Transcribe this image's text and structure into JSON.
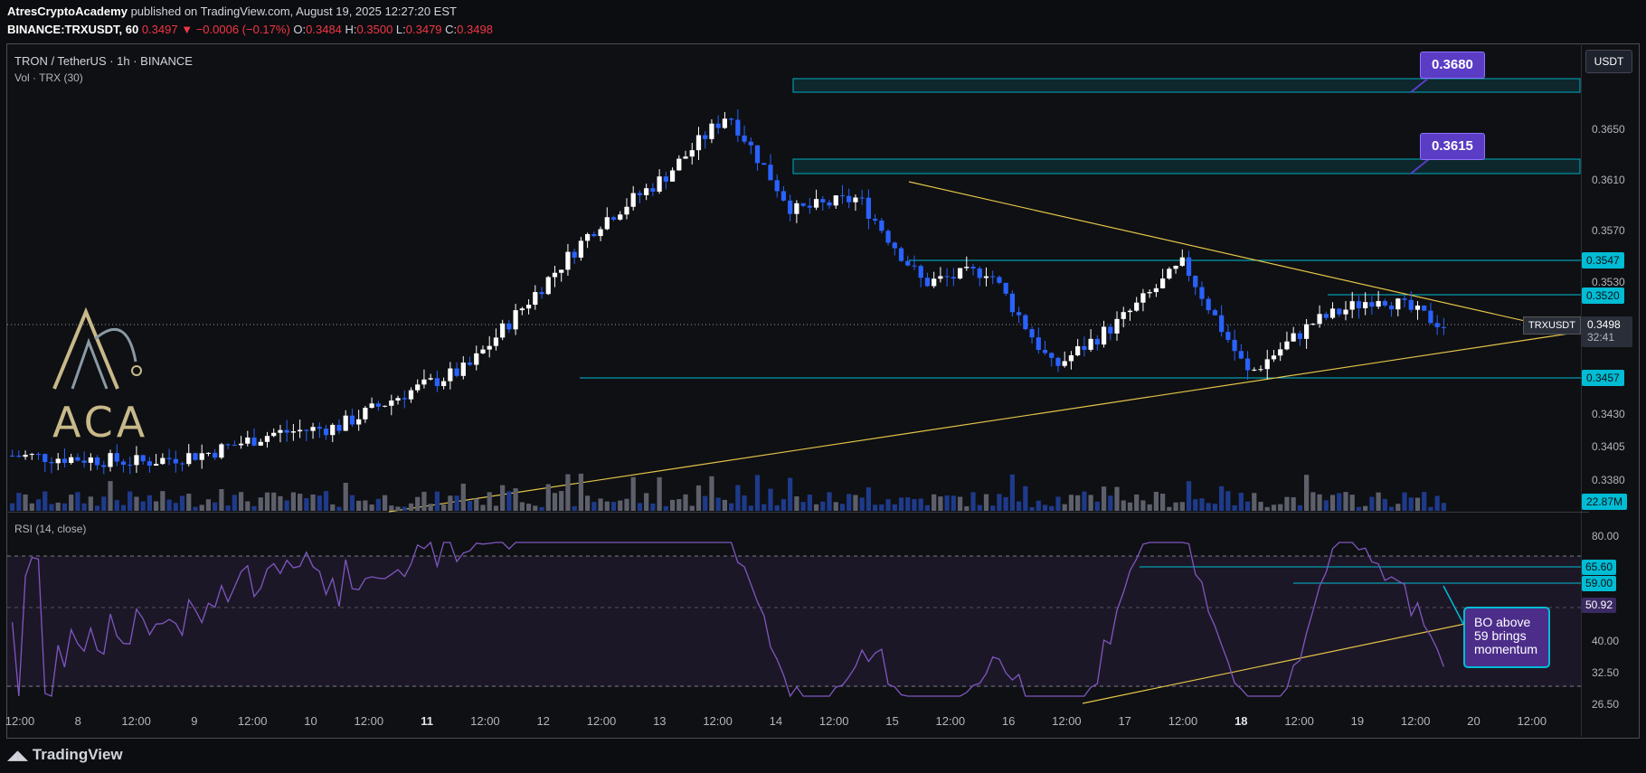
{
  "header": {
    "author": "AtresCryptoAcademy",
    "published": "published on TradingView.com, August 19, 2025 12:27:20 EST",
    "symbol": "BINANCE:TRXUSDT, 60",
    "last": "0.3497",
    "change": "−0.0006 (−0.17%)",
    "o_label": "O:",
    "o": "0.3484",
    "h_label": "H:",
    "h": "0.3500",
    "l_label": "L:",
    "l": "0.3479",
    "c_label": "C:",
    "c": "0.3498"
  },
  "chart": {
    "title": "TRON / TetherUS · 1h · BINANCE",
    "vol_label": "Vol · TRX (30)",
    "currency": "USDT",
    "symbol_tag": "TRXUSDT",
    "last_price": "0.3498",
    "countdown": "32:41",
    "volume_value": "22.87M",
    "price_axis": [
      "0.3650",
      "0.3610",
      "0.3570",
      "0.3530",
      "0.3430",
      "0.3405",
      "0.3380"
    ],
    "level_tags": [
      "0.3547",
      "0.3520",
      "0.3457"
    ],
    "callouts": [
      "0.3680",
      "0.3615"
    ],
    "logo_text": "ACA"
  },
  "rsi": {
    "title": "RSI (14, close)",
    "axis": [
      "80.00",
      "40.00",
      "32.50",
      "26.50"
    ],
    "tags": [
      "65.60",
      "59.00",
      "50.92"
    ],
    "note": [
      "BO above",
      "59 brings",
      "momentum"
    ]
  },
  "time_axis": [
    {
      "t": "12:00",
      "bold": false
    },
    {
      "t": "8",
      "bold": false
    },
    {
      "t": "12:00",
      "bold": false
    },
    {
      "t": "9",
      "bold": false
    },
    {
      "t": "12:00",
      "bold": false
    },
    {
      "t": "10",
      "bold": false
    },
    {
      "t": "12:00",
      "bold": false
    },
    {
      "t": "11",
      "bold": true
    },
    {
      "t": "12:00",
      "bold": false
    },
    {
      "t": "12",
      "bold": false
    },
    {
      "t": "12:00",
      "bold": false
    },
    {
      "t": "13",
      "bold": false
    },
    {
      "t": "12:00",
      "bold": false
    },
    {
      "t": "14",
      "bold": false
    },
    {
      "t": "12:00",
      "bold": false
    },
    {
      "t": "15",
      "bold": false
    },
    {
      "t": "12:00",
      "bold": false
    },
    {
      "t": "16",
      "bold": false
    },
    {
      "t": "12:00",
      "bold": false
    },
    {
      "t": "17",
      "bold": false
    },
    {
      "t": "12:00",
      "bold": false
    },
    {
      "t": "18",
      "bold": true
    },
    {
      "t": "12:00",
      "bold": false
    },
    {
      "t": "19",
      "bold": false
    },
    {
      "t": "12:00",
      "bold": false
    },
    {
      "t": "20",
      "bold": false
    },
    {
      "t": "12:00",
      "bold": false
    }
  ],
  "footer": {
    "brand": "TradingView"
  },
  "colors": {
    "up": "#ffffff",
    "down": "#2962ff",
    "level": "#00bcd4",
    "trend": "#e3c44a",
    "rsi": "#7e57c2",
    "callout": "#5b3cc4"
  },
  "chart_data": {
    "type": "candlestick",
    "title": "TRON / TetherUS · 1h · BINANCE",
    "y_axis_ticks": [
      0.365,
      0.361,
      0.357,
      0.353,
      0.343,
      0.3405,
      0.338
    ],
    "close_path": [
      {
        "x": "7 12:00",
        "y": 0.3398
      },
      {
        "x": "8 12:00",
        "y": 0.3396
      },
      {
        "x": "9 12:00",
        "y": 0.3393
      },
      {
        "x": "10 12:00",
        "y": 0.34
      },
      {
        "x": "11",
        "y": 0.3415
      },
      {
        "x": "11 12:00",
        "y": 0.342
      },
      {
        "x": "12",
        "y": 0.3445
      },
      {
        "x": "12 12:00",
        "y": 0.3465
      },
      {
        "x": "13",
        "y": 0.352
      },
      {
        "x": "13 12:00",
        "y": 0.3575
      },
      {
        "x": "14",
        "y": 0.361
      },
      {
        "x": "14 12:00",
        "y": 0.366
      },
      {
        "x": "15",
        "y": 0.3585
      },
      {
        "x": "15 12:00",
        "y": 0.3595
      },
      {
        "x": "16",
        "y": 0.353
      },
      {
        "x": "16 12:00",
        "y": 0.354
      },
      {
        "x": "17",
        "y": 0.3465
      },
      {
        "x": "17 12:00",
        "y": 0.35
      },
      {
        "x": "18",
        "y": 0.3545
      },
      {
        "x": "18 12:00",
        "y": 0.346
      },
      {
        "x": "19",
        "y": 0.35
      },
      {
        "x": "19 12:00",
        "y": 0.352
      },
      {
        "x": "19 15:00",
        "y": 0.3498
      }
    ],
    "levels": [
      0.368,
      0.3615,
      0.3547,
      0.352,
      0.3457
    ],
    "rsi_levels": [
      65.6,
      59.0,
      50.92
    ]
  }
}
